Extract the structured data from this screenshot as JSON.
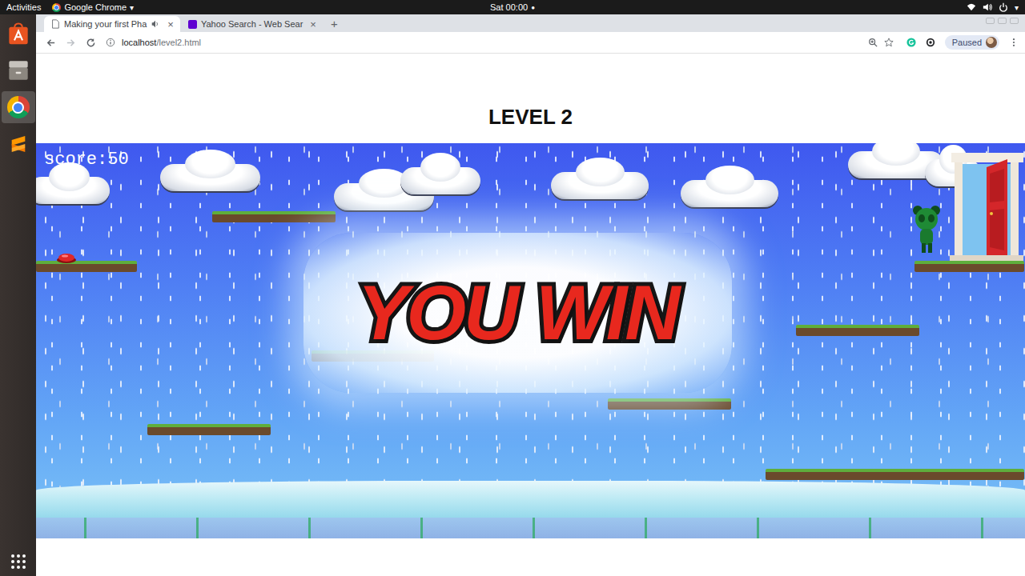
{
  "topbar": {
    "activities": "Activities",
    "app_menu": "Google Chrome",
    "app_menu_arrow": "▾",
    "clock": "Sat 00:00",
    "clock_dot": "●",
    "tray_arrow": "▾"
  },
  "dock": [
    {
      "kind": "software",
      "selected": false
    },
    {
      "kind": "files",
      "selected": false
    },
    {
      "kind": "chrome",
      "selected": true
    },
    {
      "kind": "sublime",
      "selected": false
    }
  ],
  "browser": {
    "tabs": [
      {
        "label": "Making your first Pha",
        "kind": "page",
        "selected": true,
        "audio": true,
        "close": "×"
      },
      {
        "label": "Yahoo Search - Web Sear",
        "kind": "yahoo",
        "selected": false,
        "audio": false,
        "close": "×"
      }
    ],
    "new_tab": "+",
    "address": {
      "host": "localhost",
      "path": "/level2.html"
    },
    "profile": {
      "status": "Paused"
    }
  },
  "page": {
    "heading": "LEVEL 2"
  },
  "game": {
    "score": "score:50",
    "banner": "YOU WIN"
  }
}
